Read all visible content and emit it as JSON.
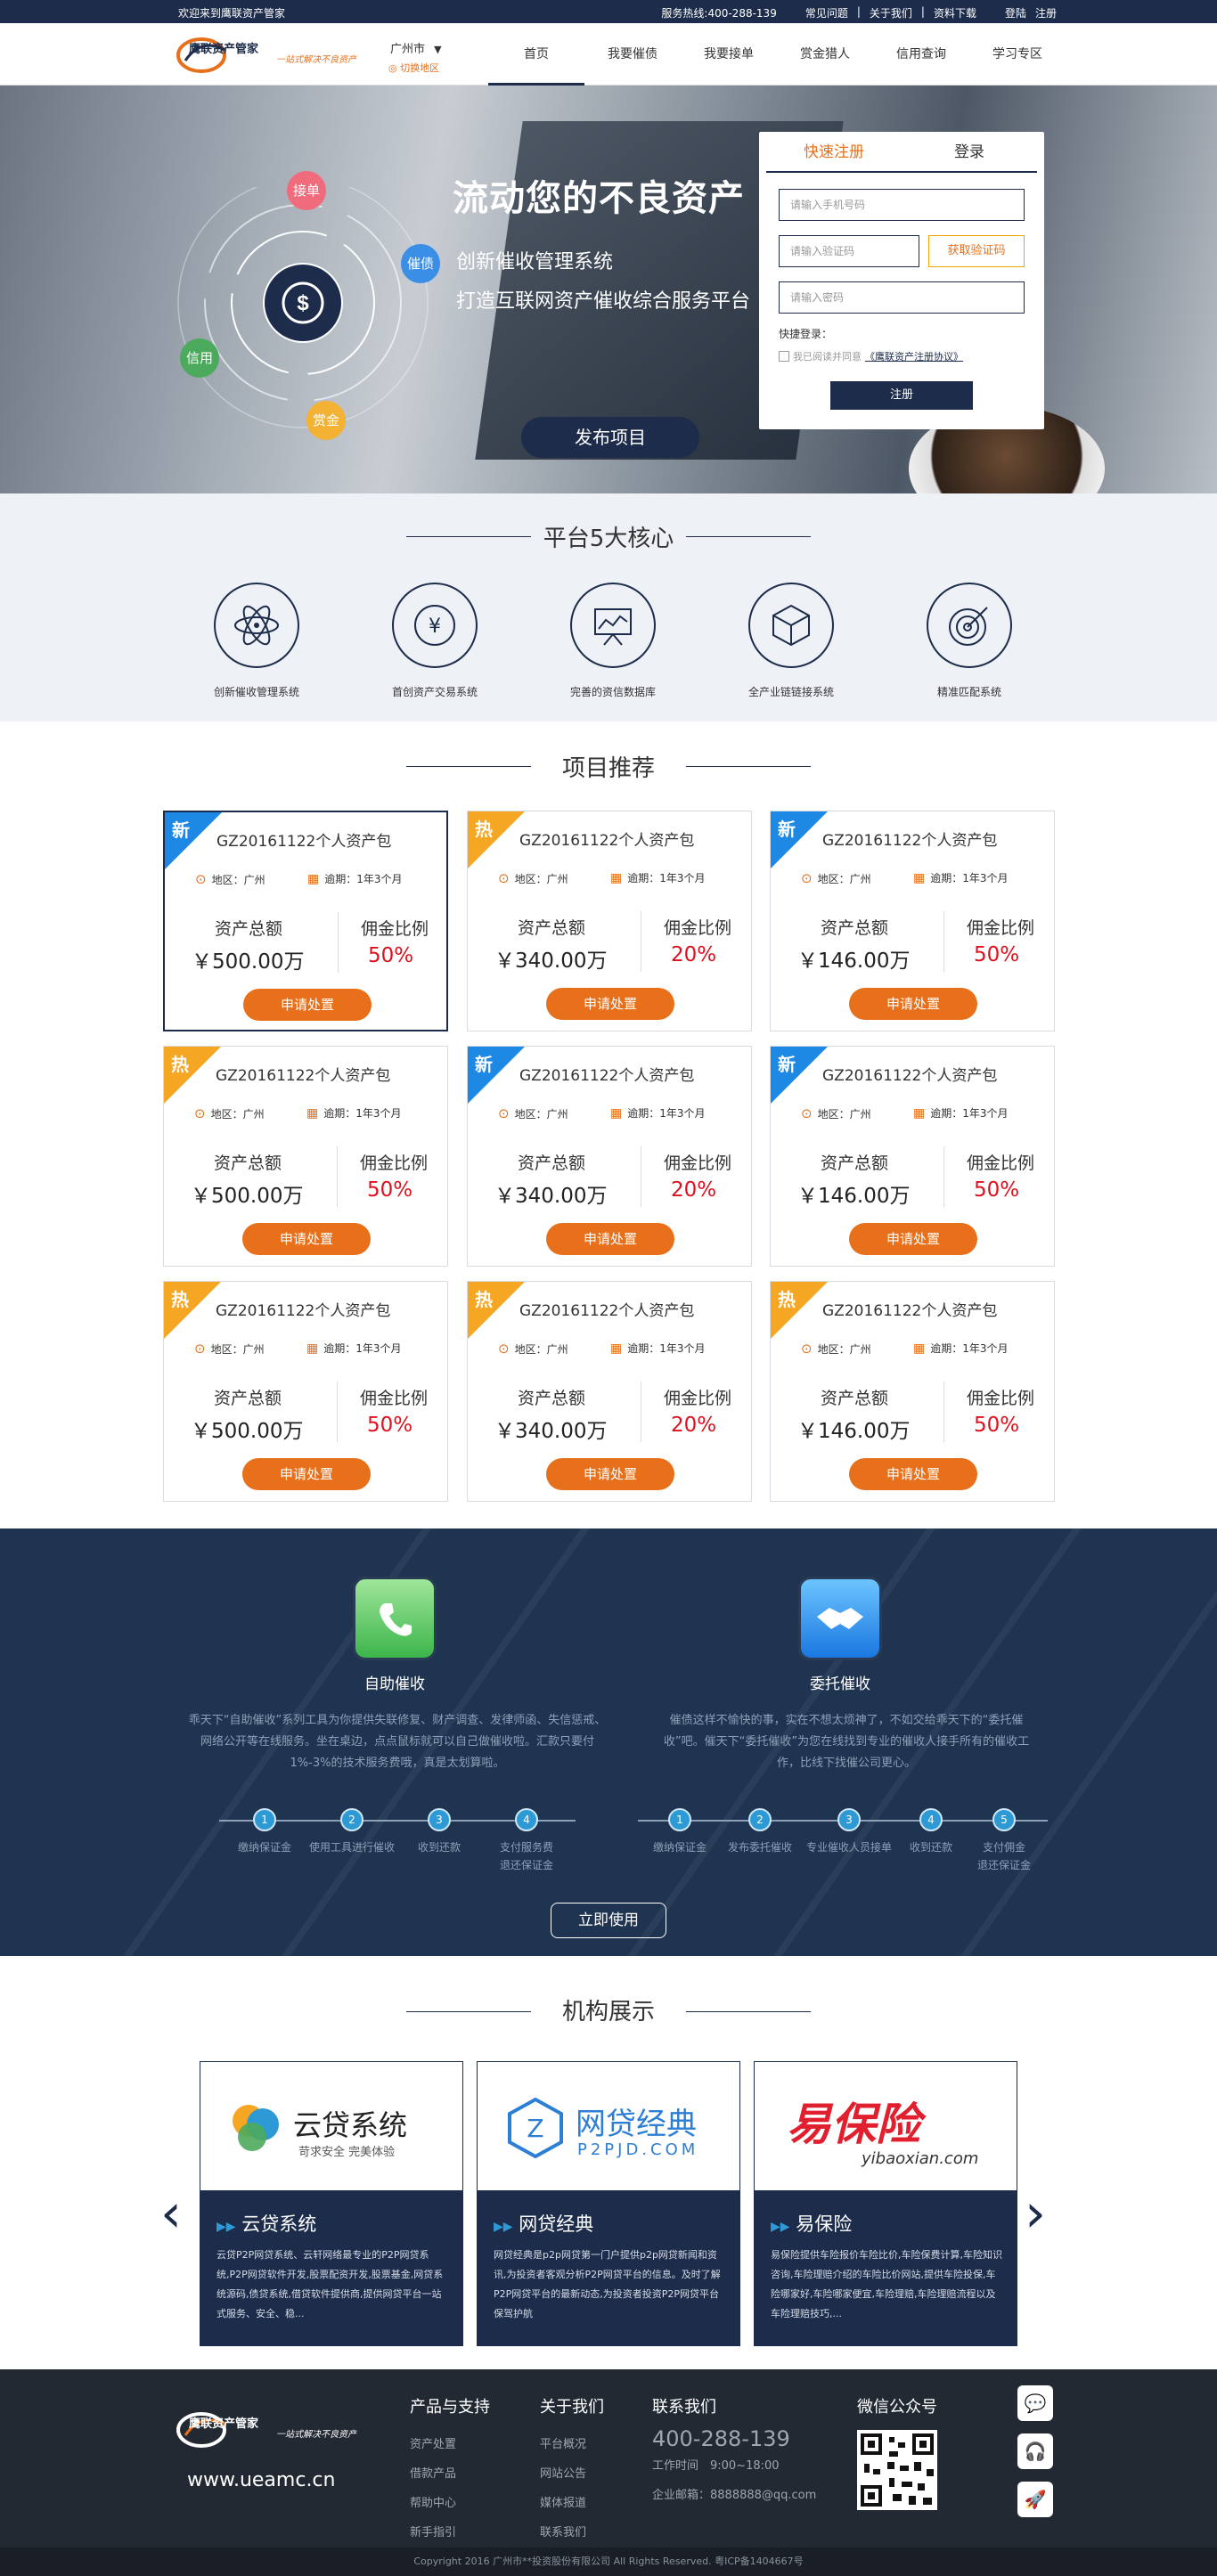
{
  "topbar": {
    "welcome": "欢迎来到鹰联资产管家",
    "hotline": "服务热线:400-288-139",
    "links": [
      "常见问题",
      "|",
      "关于我们",
      "|",
      "资料下载",
      "登陆",
      "注册"
    ]
  },
  "header": {
    "logo_text": "鹰联资产管家",
    "logo_slogan": "一站式解决不良资产",
    "city": "广州市",
    "city_switch": "切换地区",
    "nav": [
      "首页",
      "我要催债",
      "我要接单",
      "赏金猎人",
      "信用查询",
      "学习专区"
    ]
  },
  "banner": {
    "title": "流动您的不良资产",
    "sub1": "创新催收管理系统",
    "sub2": "打造互联网资产催收综合服务平台",
    "publish": "发布项目",
    "bubbles": [
      "接单",
      "催债",
      "信用",
      "赏金"
    ],
    "colors": {
      "接单": "#f06c7d",
      "催债": "#3a8ee6",
      "信用": "#4caa5c",
      "赏金": "#f3b233"
    }
  },
  "login": {
    "tab_register": "快速注册",
    "tab_login": "登录",
    "phone_placeholder": "请输入手机号码",
    "code_placeholder": "请输入验证码",
    "get_code": "获取验证码",
    "password_placeholder": "请输入密码",
    "quick_login": "快捷登录：",
    "agree_prefix": "我已阅读并同意",
    "agree_link": "《鹰联资产注册协议》",
    "submit": "注册"
  },
  "core": {
    "title": "平台5大核心",
    "items": [
      {
        "label": "创新催收管理系统",
        "icon": "atom-icon"
      },
      {
        "label": "首创资产交易系统",
        "icon": "yen-icon"
      },
      {
        "label": "完善的资信数据库",
        "icon": "chart-board-icon"
      },
      {
        "label": "全产业链链接系统",
        "icon": "cube-icon"
      },
      {
        "label": "精准匹配系统",
        "icon": "target-icon"
      }
    ]
  },
  "projects": {
    "title": "项目推荐",
    "cards": [
      {
        "tag": "新",
        "name": "GZ20161122个人资产包",
        "region": "地区：广州",
        "overdue": "逾期：1年3个月",
        "amount_label": "资产总额",
        "amount": "￥500.00万",
        "rate_label": "佣金比例",
        "rate": "50%",
        "button": "申请处置"
      },
      {
        "tag": "热",
        "name": "GZ20161122个人资产包",
        "region": "地区：广州",
        "overdue": "逾期：1年3个月",
        "amount_label": "资产总额",
        "amount": "￥340.00万",
        "rate_label": "佣金比例",
        "rate": "20%",
        "button": "申请处置"
      },
      {
        "tag": "新",
        "name": "GZ20161122个人资产包",
        "region": "地区：广州",
        "overdue": "逾期：1年3个月",
        "amount_label": "资产总额",
        "amount": "￥146.00万",
        "rate_label": "佣金比例",
        "rate": "50%",
        "button": "申请处置"
      },
      {
        "tag": "热",
        "name": "GZ20161122个人资产包",
        "region": "地区：广州",
        "overdue": "逾期：1年3个月",
        "amount_label": "资产总额",
        "amount": "￥500.00万",
        "rate_label": "佣金比例",
        "rate": "50%",
        "button": "申请处置"
      },
      {
        "tag": "新",
        "name": "GZ20161122个人资产包",
        "region": "地区：广州",
        "overdue": "逾期：1年3个月",
        "amount_label": "资产总额",
        "amount": "￥340.00万",
        "rate_label": "佣金比例",
        "rate": "20%",
        "button": "申请处置"
      },
      {
        "tag": "新",
        "name": "GZ20161122个人资产包",
        "region": "地区：广州",
        "overdue": "逾期：1年3个月",
        "amount_label": "资产总额",
        "amount": "￥146.00万",
        "rate_label": "佣金比例",
        "rate": "50%",
        "button": "申请处置"
      },
      {
        "tag": "热",
        "name": "GZ20161122个人资产包",
        "region": "地区：广州",
        "overdue": "逾期：1年3个月",
        "amount_label": "资产总额",
        "amount": "￥500.00万",
        "rate_label": "佣金比例",
        "rate": "50%",
        "button": "申请处置"
      },
      {
        "tag": "热",
        "name": "GZ20161122个人资产包",
        "region": "地区：广州",
        "overdue": "逾期：1年3个月",
        "amount_label": "资产总额",
        "amount": "￥340.00万",
        "rate_label": "佣金比例",
        "rate": "20%",
        "button": "申请处置"
      },
      {
        "tag": "热",
        "name": "GZ20161122个人资产包",
        "region": "地区：广州",
        "overdue": "逾期：1年3个月",
        "amount_label": "资产总额",
        "amount": "￥146.00万",
        "rate_label": "佣金比例",
        "rate": "50%",
        "button": "申请处置"
      }
    ],
    "tag_colors": {
      "新": "#1e88e5",
      "热": "#f5a623"
    }
  },
  "collection": {
    "self": {
      "title": "自助催收",
      "desc": "乖天下“自助催收”系列工具为你提供失联修复、财产调查、发律师函、失信惩戒、网络公开等在线服务。坐在桌边，点点鼠标就可以自己做催收啦。汇款只要付1%-3%的技术服务费哦，真是太划算啦。",
      "steps": [
        "缴纳保证金",
        "使用工具进行催收",
        "收到还款",
        "支付服务费\n退还保证金"
      ]
    },
    "entrust": {
      "title": "委托催收",
      "desc": "催债这样不愉快的事，实在不想太烦神了，不如交给乖天下的“委托催收”吧。催天下“委托催收”为您在线找到专业的催收人接手所有的催收工作，比线下找催公司更心。",
      "steps": [
        "缴纳保证金",
        "发布委托催收",
        "专业催收人员接单",
        "收到还款",
        "支付佣金\n退还保证金"
      ]
    },
    "button": "立即使用"
  },
  "partners": {
    "title": "机构展示",
    "items": [
      {
        "name": "云贷系统",
        "logo_main": "云贷系统",
        "logo_sub": "苛求安全 完美体验",
        "desc": "云贷P2P网贷系统、云轩网络最专业的P2P网贷系统,P2P网贷软件开发,股票配资开发,股票基金,网贷系统源码,债贷系统,借贷软件提供商,提供网贷平台一站式服务、安全、稳..."
      },
      {
        "name": "网贷经典",
        "logo_main": "网贷经典",
        "logo_sub": "P2PJD.COM",
        "desc": "网贷经典是p2p网贷第一门户提供p2p网贷新闻和资讯,为投资者客观分析P2P网贷平台的信息。及时了解P2P网贷平台的最新动态,为投资者投资P2P网贷平台保驾护航"
      },
      {
        "name": "易保险",
        "logo_main": "易保险",
        "logo_sub": "yibaoxian.com",
        "desc": "易保险提供车险报价车险比价,车险保费计算,车险知识咨询,车险理赔介绍的车险比价网站,提供车险投保,车险哪家好,车险哪家便宜,车险理赔,车险理赔流程以及车险理赔技巧,..."
      }
    ]
  },
  "footer": {
    "site": "www.ueamc.cn",
    "logo_text": "鹰联资产管家",
    "logo_slogan": "一站式解决不良资产",
    "cols": [
      {
        "title": "产品与支持",
        "links": [
          "资产处置",
          "借款产品",
          "帮助中心",
          "新手指引"
        ]
      },
      {
        "title": "关于我们",
        "links": [
          "平台概况",
          "网站公告",
          "媒体报道",
          "联系我们"
        ]
      }
    ],
    "contact_title": "联系我们",
    "phone": "400-288-139",
    "hours": "工作时间　9:00~18:00",
    "email": "企业邮箱：8888888@qq.com",
    "wechat": "微信公众号",
    "copyright": "Copyright 2016 广州市**投资股份有限公司 All Rights Reserved. 粤ICP备1404667号"
  }
}
